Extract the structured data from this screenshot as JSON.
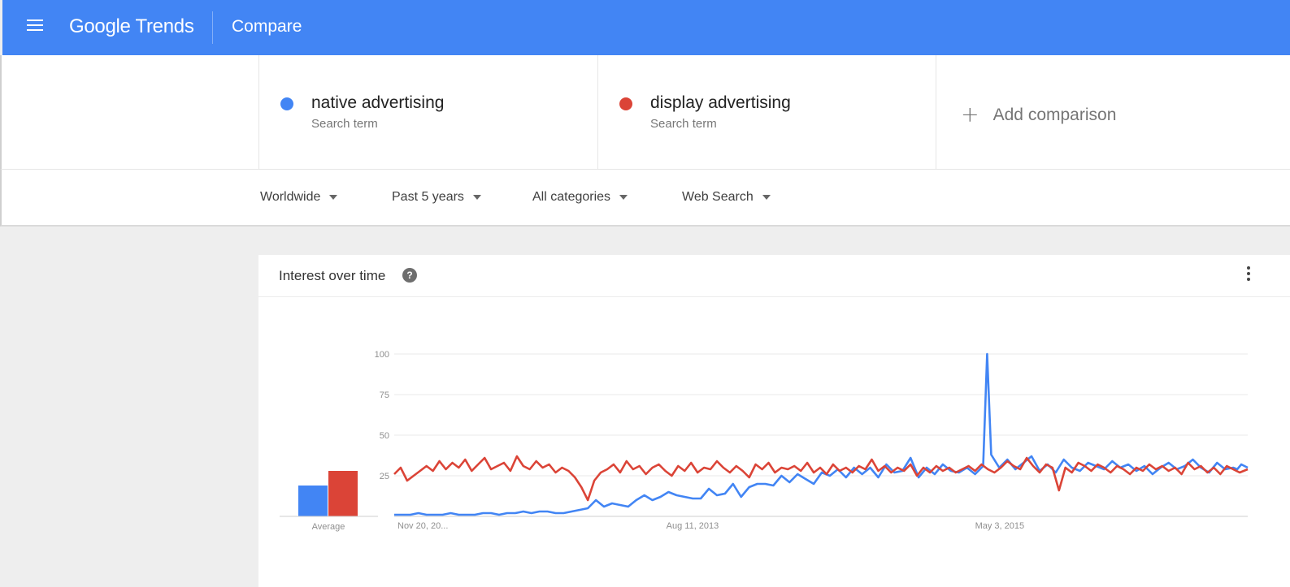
{
  "app": {
    "logo": "Google Trends",
    "page_title": "Compare",
    "brand_color": "#4285f4"
  },
  "terms": [
    {
      "name": "native advertising",
      "type": "Search term",
      "color": "#4285f4"
    },
    {
      "name": "display advertising",
      "type": "Search term",
      "color": "#db4437"
    }
  ],
  "add_comparison": "Add comparison",
  "filters": [
    {
      "label": "Worldwide"
    },
    {
      "label": "Past 5 years"
    },
    {
      "label": "All categories"
    },
    {
      "label": "Web Search"
    }
  ],
  "card": {
    "title": "Interest over time",
    "help_icon": "help-icon",
    "menu_icon": "more-vert-icon"
  },
  "chart_data": {
    "type": "line",
    "x_range": [
      "2011-11-20",
      "2016-11-13"
    ],
    "x_ticks": [
      "Nov 20, 20...",
      "Aug 11, 2013",
      "May 3, 2015"
    ],
    "y_ticks": [
      100,
      75,
      50,
      25
    ],
    "ylim": [
      0,
      100
    ],
    "grid": true,
    "series": [
      {
        "name": "native advertising",
        "color": "#4285f4",
        "points": [
          [
            0,
            1
          ],
          [
            10,
            1
          ],
          [
            20,
            1
          ],
          [
            30,
            2
          ],
          [
            40,
            1
          ],
          [
            50,
            1
          ],
          [
            60,
            1
          ],
          [
            70,
            2
          ],
          [
            80,
            1
          ],
          [
            90,
            1
          ],
          [
            100,
            1
          ],
          [
            110,
            2
          ],
          [
            120,
            2
          ],
          [
            130,
            1
          ],
          [
            140,
            2
          ],
          [
            150,
            2
          ],
          [
            160,
            3
          ],
          [
            170,
            2
          ],
          [
            180,
            3
          ],
          [
            190,
            3
          ],
          [
            200,
            2
          ],
          [
            210,
            2
          ],
          [
            220,
            3
          ],
          [
            230,
            4
          ],
          [
            240,
            5
          ],
          [
            250,
            10
          ],
          [
            260,
            6
          ],
          [
            270,
            8
          ],
          [
            280,
            7
          ],
          [
            290,
            6
          ],
          [
            300,
            10
          ],
          [
            310,
            13
          ],
          [
            320,
            10
          ],
          [
            330,
            12
          ],
          [
            340,
            15
          ],
          [
            350,
            13
          ],
          [
            360,
            12
          ],
          [
            370,
            11
          ],
          [
            380,
            11
          ],
          [
            390,
            17
          ],
          [
            400,
            13
          ],
          [
            410,
            14
          ],
          [
            420,
            20
          ],
          [
            430,
            12
          ],
          [
            440,
            18
          ],
          [
            450,
            20
          ],
          [
            460,
            20
          ],
          [
            470,
            19
          ],
          [
            480,
            25
          ],
          [
            490,
            21
          ],
          [
            500,
            26
          ],
          [
            510,
            23
          ],
          [
            520,
            20
          ],
          [
            530,
            27
          ],
          [
            540,
            25
          ],
          [
            550,
            29
          ],
          [
            560,
            24
          ],
          [
            570,
            30
          ],
          [
            580,
            26
          ],
          [
            590,
            30
          ],
          [
            600,
            24
          ],
          [
            610,
            32
          ],
          [
            620,
            27
          ],
          [
            630,
            28
          ],
          [
            640,
            36
          ],
          [
            650,
            24
          ],
          [
            660,
            30
          ],
          [
            670,
            26
          ],
          [
            680,
            32
          ],
          [
            690,
            28
          ],
          [
            700,
            27
          ],
          [
            710,
            30
          ],
          [
            720,
            26
          ],
          [
            730,
            31
          ],
          [
            735,
            100
          ],
          [
            740,
            38
          ],
          [
            750,
            30
          ],
          [
            760,
            35
          ],
          [
            770,
            29
          ],
          [
            780,
            33
          ],
          [
            790,
            37
          ],
          [
            800,
            28
          ],
          [
            810,
            32
          ],
          [
            820,
            27
          ],
          [
            830,
            35
          ],
          [
            840,
            30
          ],
          [
            850,
            28
          ],
          [
            860,
            33
          ],
          [
            870,
            31
          ],
          [
            880,
            29
          ],
          [
            890,
            34
          ],
          [
            900,
            30
          ],
          [
            910,
            32
          ],
          [
            920,
            28
          ],
          [
            930,
            31
          ],
          [
            940,
            26
          ],
          [
            950,
            30
          ],
          [
            960,
            33
          ],
          [
            970,
            29
          ],
          [
            980,
            31
          ],
          [
            990,
            35
          ],
          [
            1000,
            30
          ],
          [
            1010,
            27
          ],
          [
            1020,
            33
          ],
          [
            1030,
            29
          ],
          [
            1040,
            30
          ],
          [
            1045,
            29
          ],
          [
            1050,
            32
          ],
          [
            1058,
            30
          ]
        ]
      },
      {
        "name": "display advertising",
        "color": "#db4437",
        "points": [
          [
            0,
            26
          ],
          [
            8,
            30
          ],
          [
            16,
            22
          ],
          [
            24,
            25
          ],
          [
            32,
            28
          ],
          [
            40,
            31
          ],
          [
            48,
            28
          ],
          [
            56,
            34
          ],
          [
            64,
            29
          ],
          [
            72,
            33
          ],
          [
            80,
            30
          ],
          [
            88,
            35
          ],
          [
            96,
            28
          ],
          [
            104,
            32
          ],
          [
            112,
            36
          ],
          [
            120,
            29
          ],
          [
            128,
            31
          ],
          [
            136,
            33
          ],
          [
            144,
            28
          ],
          [
            152,
            37
          ],
          [
            160,
            31
          ],
          [
            168,
            29
          ],
          [
            176,
            34
          ],
          [
            184,
            30
          ],
          [
            192,
            32
          ],
          [
            200,
            27
          ],
          [
            208,
            30
          ],
          [
            216,
            28
          ],
          [
            224,
            24
          ],
          [
            232,
            18
          ],
          [
            240,
            10
          ],
          [
            248,
            22
          ],
          [
            256,
            27
          ],
          [
            264,
            29
          ],
          [
            272,
            32
          ],
          [
            280,
            27
          ],
          [
            288,
            34
          ],
          [
            296,
            29
          ],
          [
            304,
            31
          ],
          [
            312,
            26
          ],
          [
            320,
            30
          ],
          [
            328,
            32
          ],
          [
            336,
            28
          ],
          [
            344,
            25
          ],
          [
            352,
            31
          ],
          [
            360,
            28
          ],
          [
            368,
            33
          ],
          [
            376,
            27
          ],
          [
            384,
            30
          ],
          [
            392,
            29
          ],
          [
            400,
            34
          ],
          [
            408,
            30
          ],
          [
            416,
            27
          ],
          [
            424,
            31
          ],
          [
            432,
            28
          ],
          [
            440,
            24
          ],
          [
            448,
            32
          ],
          [
            456,
            29
          ],
          [
            464,
            33
          ],
          [
            472,
            27
          ],
          [
            480,
            30
          ],
          [
            488,
            29
          ],
          [
            496,
            31
          ],
          [
            504,
            28
          ],
          [
            512,
            33
          ],
          [
            520,
            27
          ],
          [
            528,
            30
          ],
          [
            536,
            26
          ],
          [
            544,
            32
          ],
          [
            552,
            28
          ],
          [
            560,
            30
          ],
          [
            568,
            27
          ],
          [
            576,
            31
          ],
          [
            584,
            29
          ],
          [
            592,
            35
          ],
          [
            600,
            28
          ],
          [
            608,
            31
          ],
          [
            616,
            27
          ],
          [
            624,
            30
          ],
          [
            632,
            28
          ],
          [
            640,
            32
          ],
          [
            648,
            25
          ],
          [
            656,
            30
          ],
          [
            664,
            27
          ],
          [
            672,
            31
          ],
          [
            680,
            28
          ],
          [
            688,
            30
          ],
          [
            696,
            27
          ],
          [
            704,
            29
          ],
          [
            712,
            31
          ],
          [
            720,
            28
          ],
          [
            728,
            32
          ],
          [
            736,
            29
          ],
          [
            744,
            27
          ],
          [
            752,
            30
          ],
          [
            760,
            34
          ],
          [
            768,
            31
          ],
          [
            776,
            29
          ],
          [
            784,
            36
          ],
          [
            792,
            31
          ],
          [
            800,
            27
          ],
          [
            808,
            32
          ],
          [
            816,
            30
          ],
          [
            824,
            16
          ],
          [
            832,
            30
          ],
          [
            840,
            27
          ],
          [
            848,
            33
          ],
          [
            856,
            31
          ],
          [
            864,
            28
          ],
          [
            872,
            32
          ],
          [
            880,
            30
          ],
          [
            888,
            27
          ],
          [
            896,
            31
          ],
          [
            904,
            29
          ],
          [
            912,
            26
          ],
          [
            920,
            30
          ],
          [
            928,
            28
          ],
          [
            936,
            32
          ],
          [
            944,
            29
          ],
          [
            952,
            31
          ],
          [
            960,
            28
          ],
          [
            968,
            30
          ],
          [
            976,
            26
          ],
          [
            984,
            33
          ],
          [
            992,
            29
          ],
          [
            1000,
            31
          ],
          [
            1008,
            27
          ],
          [
            1016,
            30
          ],
          [
            1024,
            26
          ],
          [
            1032,
            31
          ],
          [
            1040,
            29
          ],
          [
            1048,
            27
          ],
          [
            1058,
            29
          ]
        ]
      }
    ],
    "average": [
      {
        "name": "native advertising",
        "value": 19,
        "color": "#4285f4"
      },
      {
        "name": "display advertising",
        "value": 28,
        "color": "#db4437"
      }
    ],
    "average_label": "Average",
    "colors": {
      "grid": "#e8e8e8",
      "axis": "#cfcfcf",
      "tick_text": "#8f8f8f"
    }
  }
}
